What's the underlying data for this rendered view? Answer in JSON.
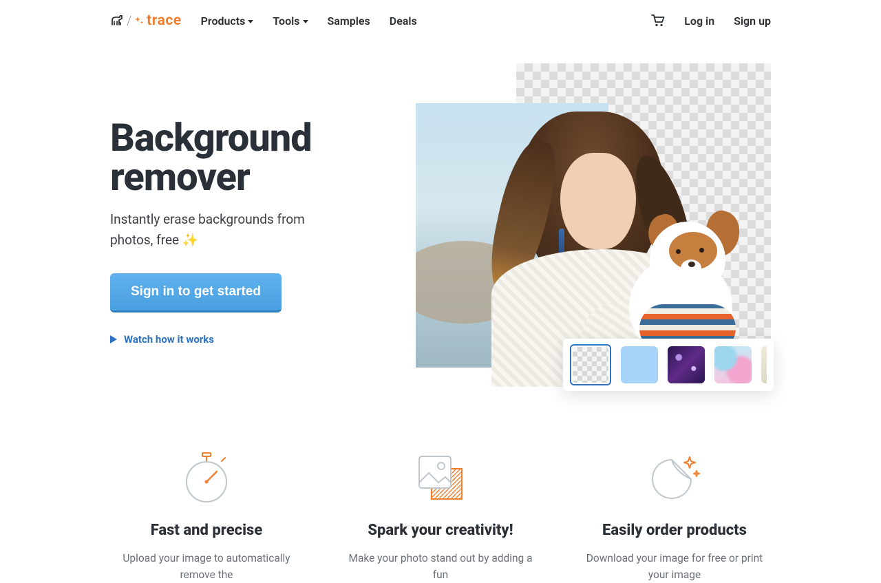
{
  "brand": {
    "name": "trace"
  },
  "nav": {
    "products": "Products",
    "tools": "Tools",
    "samples": "Samples",
    "deals": "Deals",
    "login": "Log in",
    "signup": "Sign up"
  },
  "hero": {
    "title_l1": "Background",
    "title_l2": "remover",
    "subtitle": "Instantly erase backgrounds from photos, free ✨",
    "cta": "Sign in to get started",
    "watch": "Watch how it works"
  },
  "swatches": {
    "options": [
      "transparent",
      "light-blue",
      "galaxy",
      "pastel-watercolor"
    ],
    "selected": "transparent"
  },
  "features": [
    {
      "title": "Fast and precise",
      "desc": "Upload your image to automatically remove the"
    },
    {
      "title": "Spark your creativity!",
      "desc": "Make your photo stand out by adding a fun"
    },
    {
      "title": "Easily order products",
      "desc": "Download your image for free or print your image"
    }
  ]
}
